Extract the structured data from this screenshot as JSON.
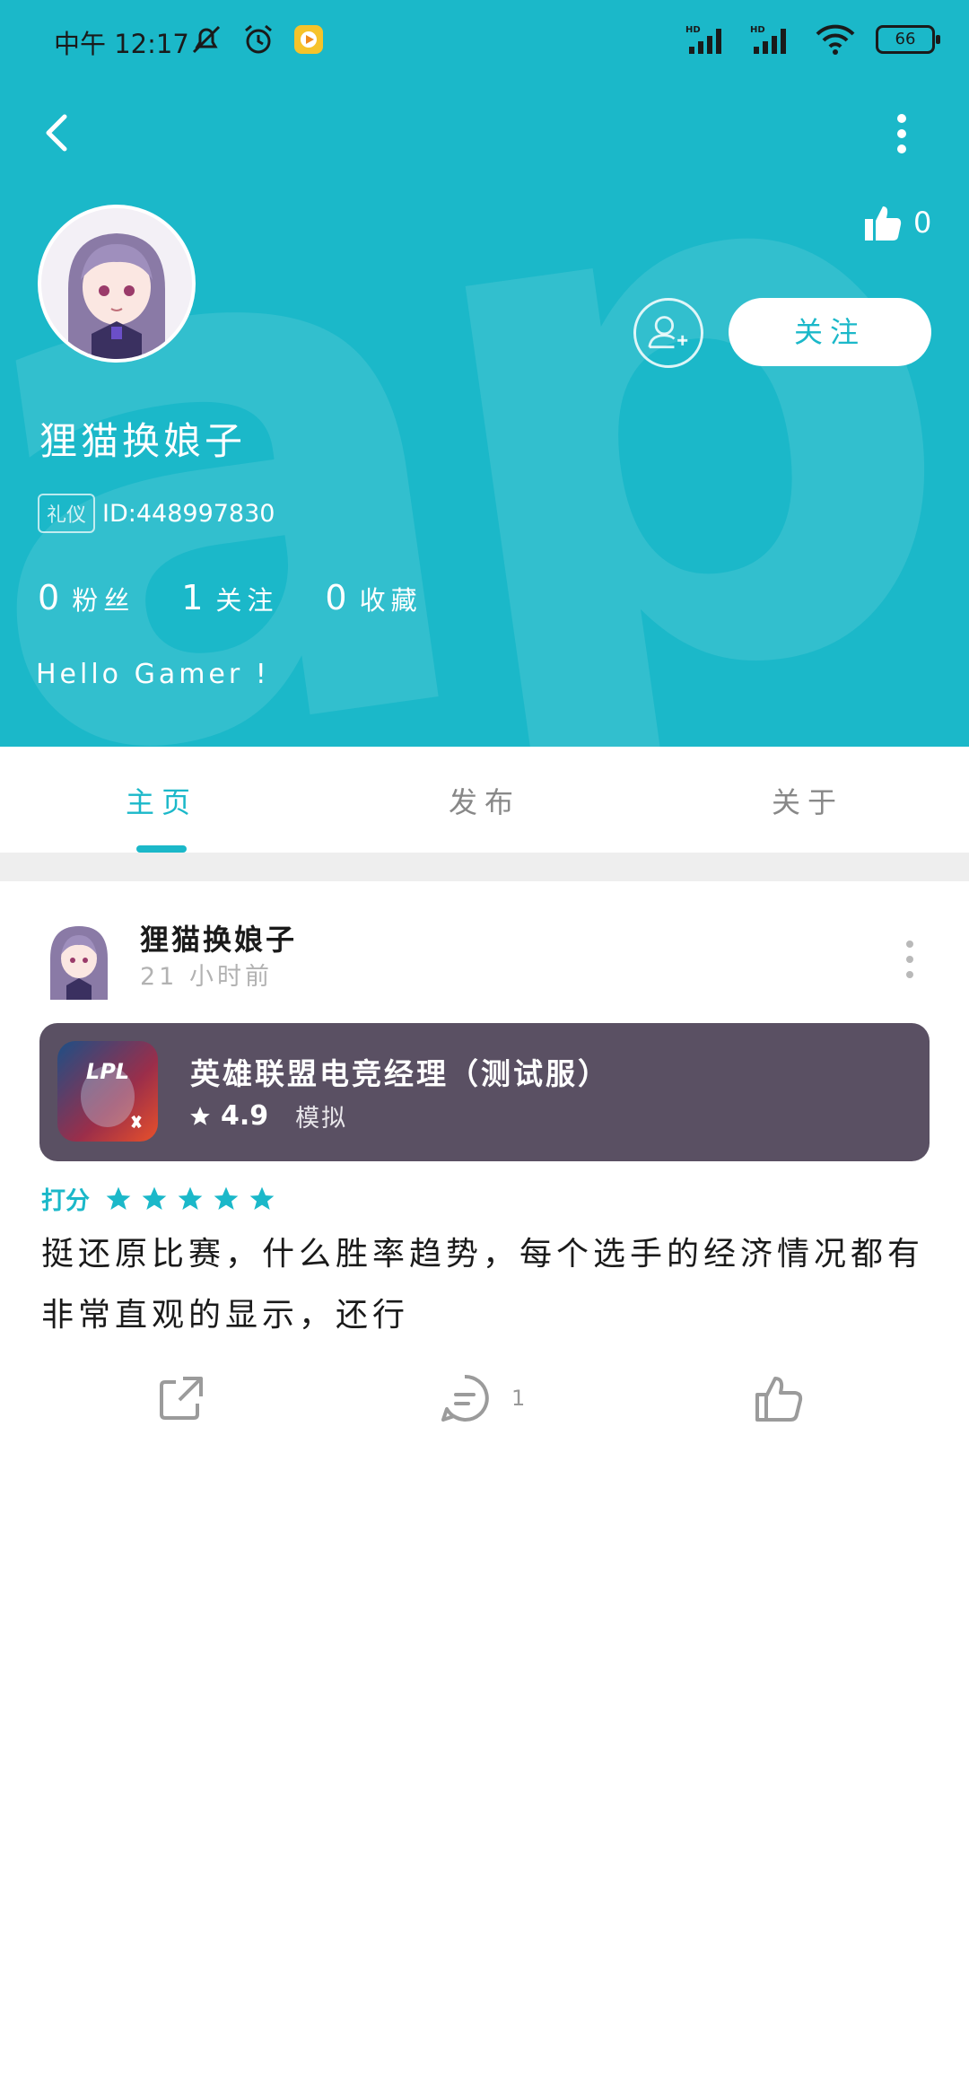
{
  "status_bar": {
    "time": "中午 12:17",
    "battery": "66"
  },
  "profile": {
    "username": "狸猫换娘子",
    "tag": "礼仪",
    "id": "ID:448997830",
    "like_count": "0",
    "follow_label": "关注",
    "stats": [
      {
        "num": "0",
        "label": "粉丝"
      },
      {
        "num": "1",
        "label": "关注"
      },
      {
        "num": "0",
        "label": "收藏"
      }
    ],
    "bio": "Hello Gamer !"
  },
  "tabs": [
    {
      "label": "主页"
    },
    {
      "label": "发布"
    },
    {
      "label": "关于"
    }
  ],
  "post": {
    "user": "狸猫换娘子",
    "time": "21 小时前",
    "game": {
      "title": "英雄联盟电竞经理（测试服）",
      "rating": "4.9",
      "genre": "模拟",
      "icon_text": "LPL"
    },
    "rating_label": "打分",
    "stars": 5,
    "text": "挺还原比赛，什么胜率趋势，每个选手的经济情况都有非常直观的显示，还行",
    "comment_count": "1"
  },
  "colors": {
    "accent": "#1bb8c9",
    "game_card": "#5a5063"
  }
}
